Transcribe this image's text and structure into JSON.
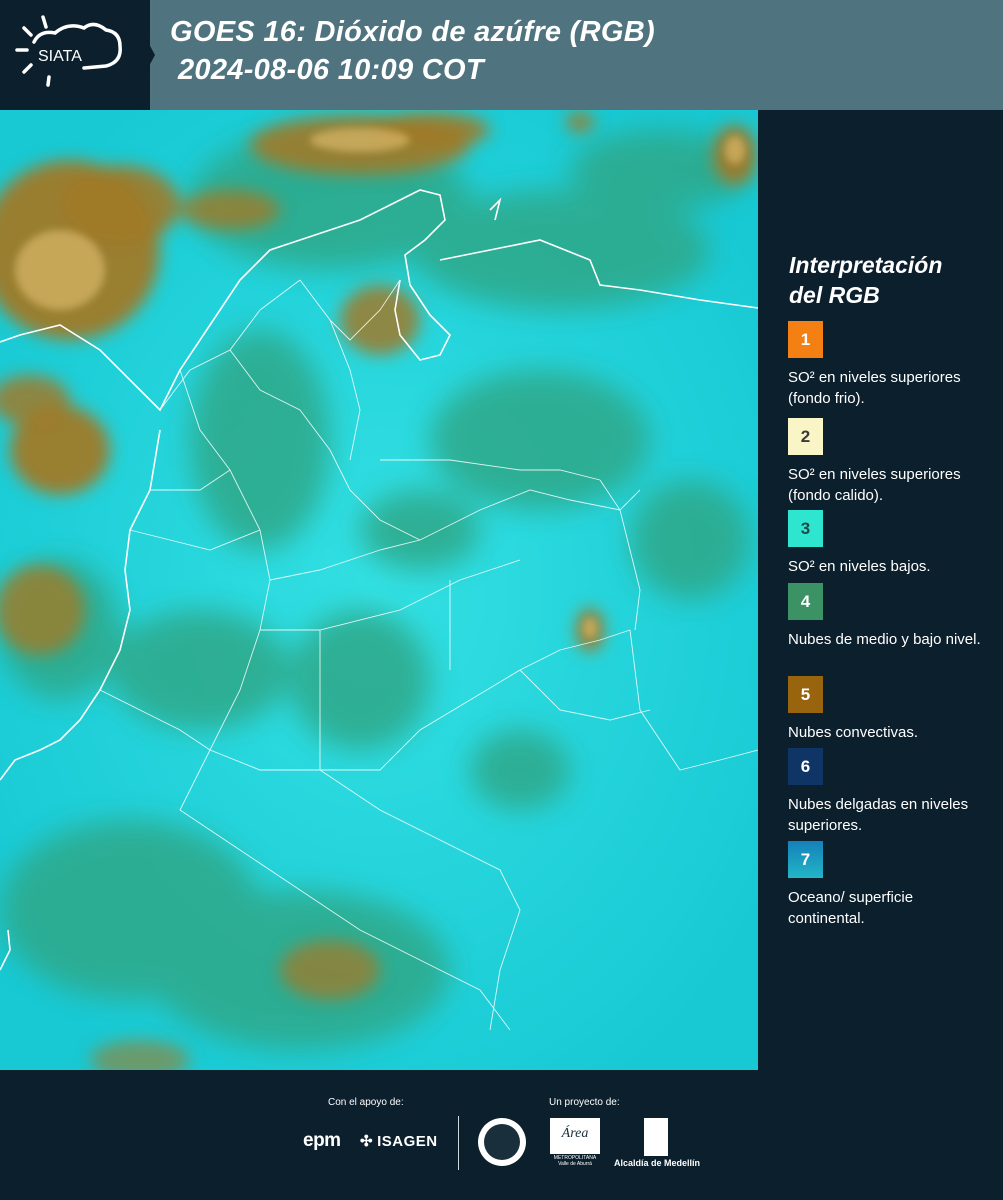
{
  "header": {
    "logo_text": "SIATA",
    "title_line1": "GOES 16: Dióxido de azúfre (RGB)",
    "title_line2": "2024-08-06 10:09 COT"
  },
  "legend": {
    "title_line1": "Interpretación",
    "title_line2": "del RGB",
    "items": [
      {
        "number": "1",
        "color": "#f47f12",
        "text": "SO² en niveles superiores (fondo frio)."
      },
      {
        "number": "2",
        "color": "#faf5c6",
        "text": "SO² en niveles superiores (fondo calido)."
      },
      {
        "number": "3",
        "color": "#2ee6cf",
        "text": "SO² en niveles bajos."
      },
      {
        "number": "4",
        "color": "#3a9265",
        "text": "Nubes de medio y bajo nivel."
      },
      {
        "number": "5",
        "color": "#98640e",
        "text": "Nubes convectivas."
      },
      {
        "number": "6",
        "color": "#0f3466",
        "text": "Nubes delgadas en niveles superiores."
      },
      {
        "number": "7",
        "color": "#1a8fb8",
        "text": "Oceano/ superficie continental."
      }
    ]
  },
  "footer": {
    "support_label": "Con el apoyo de:",
    "project_label": "Un proyecto de:",
    "partners": [
      "epm",
      "ISAGEN"
    ],
    "area_text": "METROPOLITANA Valle de Aburrá",
    "area_logo_text": "Área",
    "alcaldia_text": "Alcaldía de Medellín"
  },
  "colors": {
    "background": "#0c1f2c",
    "title_band": "#4f7480",
    "map_base": "#1fd3dc",
    "convective": "#a07a28",
    "midlow_cloud": "#2ea889"
  }
}
